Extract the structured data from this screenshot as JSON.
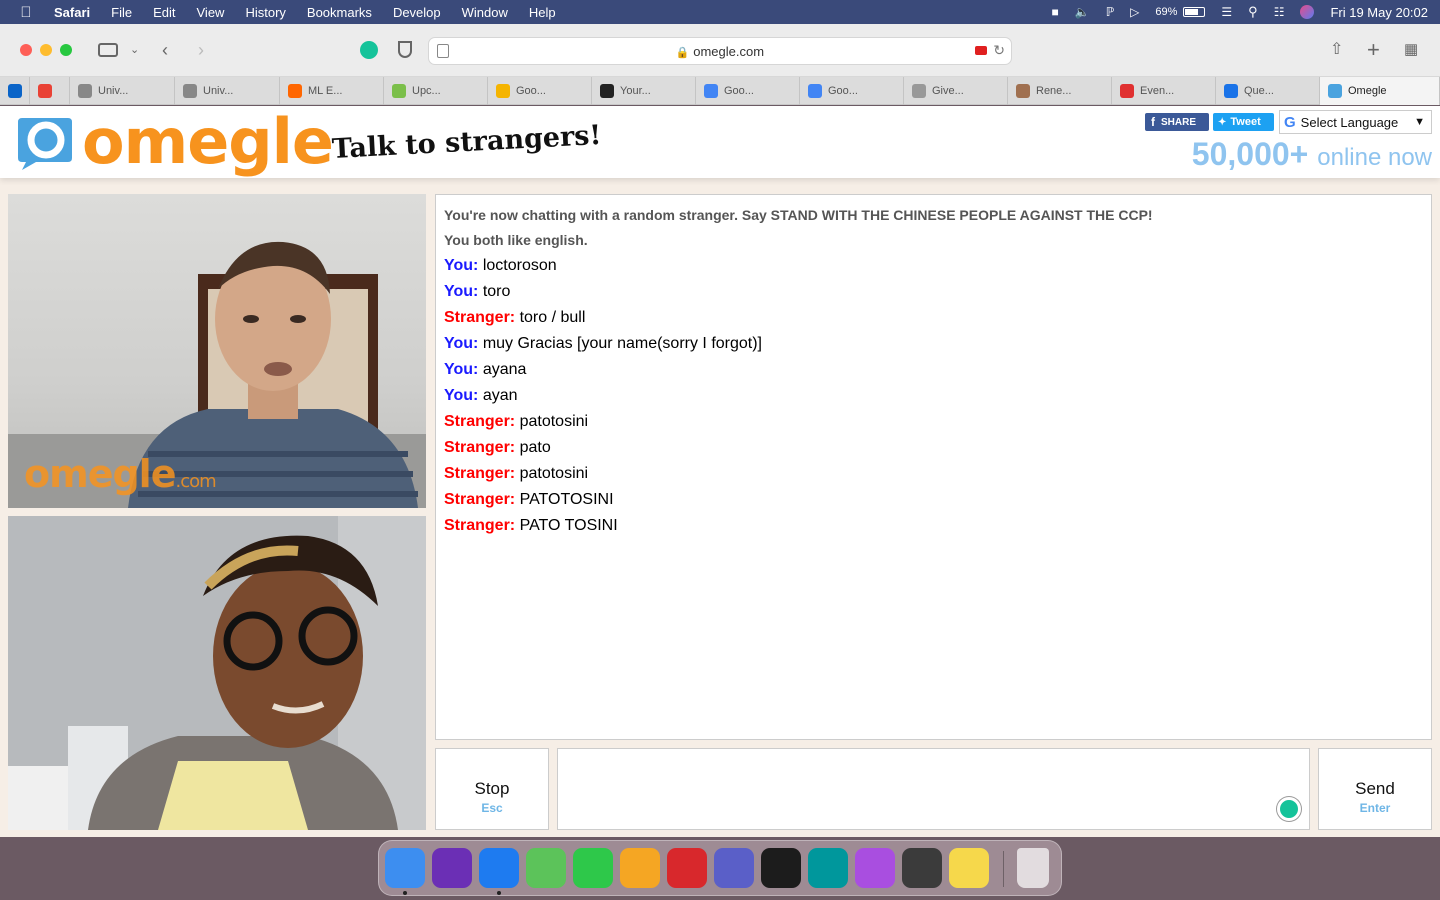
{
  "menubar": {
    "apple_icon": "apple-logo-icon",
    "app": "Safari",
    "menus": [
      "File",
      "Edit",
      "View",
      "History",
      "Bookmarks",
      "Develop",
      "Window",
      "Help"
    ],
    "battery": "69%",
    "datetime": "Fri 19 May  20:02"
  },
  "browser": {
    "url": "omegle.com",
    "tabs": [
      {
        "label": "",
        "icon": "outlook-icon",
        "color": "#0a64c8"
      },
      {
        "label": "",
        "icon": "gmail-icon",
        "color": "#e94235"
      },
      {
        "label": "Univ...",
        "icon": "s-icon",
        "color": "#888888"
      },
      {
        "label": "Univ...",
        "icon": "s-icon",
        "color": "#888888"
      },
      {
        "label": "ML E...",
        "icon": "ycombinator-icon",
        "color": "#ff6600"
      },
      {
        "label": "Upc...",
        "icon": "leaf-icon",
        "color": "#7bbf4a"
      },
      {
        "label": "Goo...",
        "icon": "google-keep-icon",
        "color": "#f5b400"
      },
      {
        "label": "Your...",
        "icon": "amazon-icon",
        "color": "#222222"
      },
      {
        "label": "Goo...",
        "icon": "google-calendar-icon",
        "color": "#4285f4"
      },
      {
        "label": "Goo...",
        "icon": "google-translate-icon",
        "color": "#4285f4"
      },
      {
        "label": "Give...",
        "icon": "loading-icon",
        "color": "#999999"
      },
      {
        "label": "Rene...",
        "icon": "globe-icon",
        "color": "#a07050"
      },
      {
        "label": "Even...",
        "icon": "ticket-icon",
        "color": "#e03030"
      },
      {
        "label": "Que...",
        "icon": "info-icon",
        "color": "#1a73e8"
      },
      {
        "label": "Omegle",
        "icon": "omegle-icon",
        "color": "#4aa3df"
      }
    ]
  },
  "header": {
    "logo": "omegle",
    "tagline": "Talk to strangers!",
    "share_label": "SHARE",
    "tweet_label": "Tweet",
    "translate_label": "Select Language",
    "online_count": "50,000+",
    "online_suffix": "online now"
  },
  "video": {
    "watermark_main": "omegle",
    "watermark_suffix": ".com"
  },
  "chat": {
    "status_lines": [
      "You're now chatting with a random stranger. Say STAND WITH THE CHINESE PEOPLE AGAINST THE CCP!",
      "You both like english."
    ],
    "messages": [
      {
        "who": "You:",
        "text": "loctoroson",
        "role": "you"
      },
      {
        "who": "You:",
        "text": "toro",
        "role": "you"
      },
      {
        "who": "Stranger:",
        "text": "toro / bull",
        "role": "stranger"
      },
      {
        "who": "You:",
        "text": "muy Gracias [your name(sorry I forgot)]",
        "role": "you"
      },
      {
        "who": "You:",
        "text": "ayana",
        "role": "you"
      },
      {
        "who": "You:",
        "text": "ayan",
        "role": "you"
      },
      {
        "who": "Stranger:",
        "text": "patotosini",
        "role": "stranger"
      },
      {
        "who": "Stranger:",
        "text": "pato",
        "role": "stranger"
      },
      {
        "who": "Stranger:",
        "text": "patotosini",
        "role": "stranger"
      },
      {
        "who": "Stranger:",
        "text": "PATOTOSINI",
        "role": "stranger"
      },
      {
        "who": "Stranger:",
        "text": "PATO TOSINI",
        "role": "stranger"
      }
    ],
    "stop_label": "Stop",
    "stop_key": "Esc",
    "send_label": "Send",
    "send_key": "Enter"
  },
  "dock": {
    "apps": [
      {
        "name": "finder-icon",
        "color": "#3d8ef0",
        "running": true
      },
      {
        "name": "siri-icon",
        "color": "#6b2fb5",
        "running": false
      },
      {
        "name": "safari-icon",
        "color": "#1e7bf0",
        "running": true
      },
      {
        "name": "maps-icon",
        "color": "#5cc35a",
        "running": false
      },
      {
        "name": "facetime-icon",
        "color": "#2ec84a",
        "running": false
      },
      {
        "name": "pages-icon",
        "color": "#f5a623",
        "running": false
      },
      {
        "name": "photo-booth-icon",
        "color": "#d8282c",
        "running": false
      },
      {
        "name": "teams-icon",
        "color": "#5a5fc8",
        "running": false
      },
      {
        "name": "apple-tv-icon",
        "color": "#1c1c1c",
        "running": false
      },
      {
        "name": "arduino-icon",
        "color": "#00979c",
        "running": false
      },
      {
        "name": "podcasts-icon",
        "color": "#a94ee0",
        "running": false
      },
      {
        "name": "sublime-text-icon",
        "color": "#3b3b3b",
        "running": false
      },
      {
        "name": "notes-icon",
        "color": "#f6d84b",
        "running": false
      }
    ],
    "trash": "trash-icon"
  }
}
